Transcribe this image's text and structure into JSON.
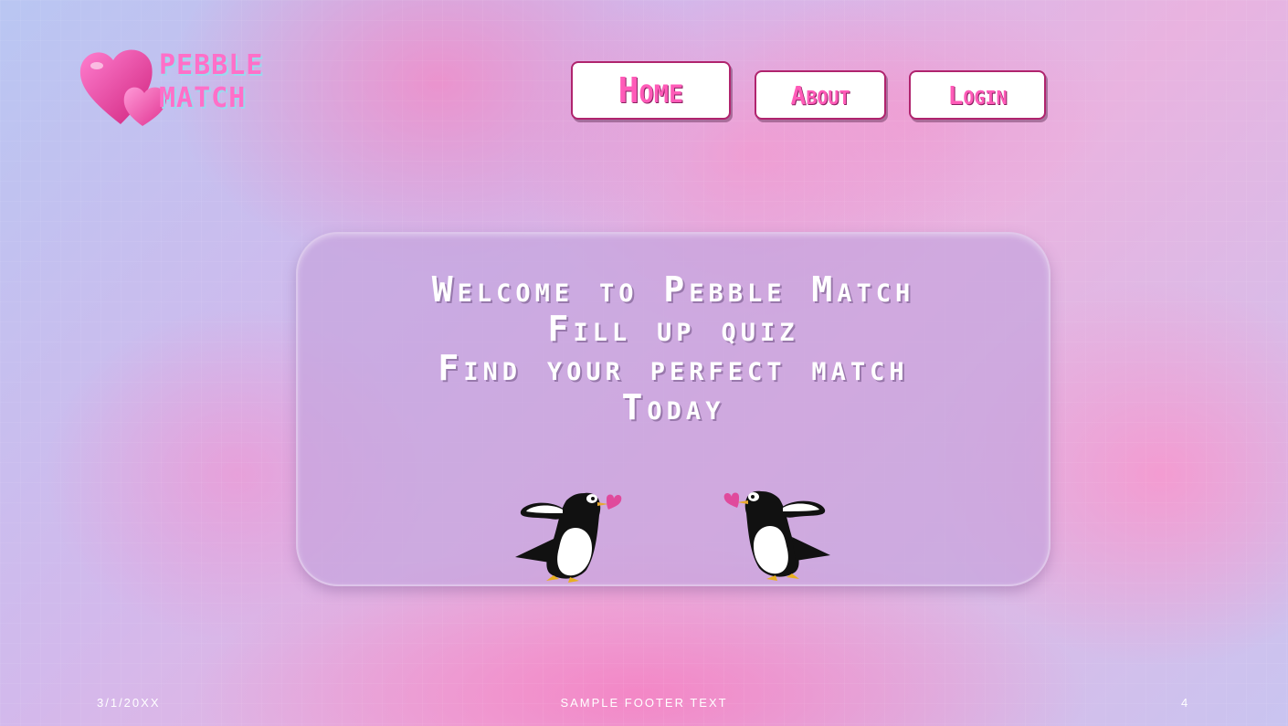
{
  "logo": {
    "line1": "Pebble",
    "line2": "Match",
    "icon": "hearts-icon"
  },
  "nav": {
    "home": "Home",
    "about": "About",
    "login": "Login"
  },
  "welcome": {
    "lines": [
      "Welcome to Pebble Match",
      "Fill up quiz",
      "Find your perfect match",
      "Today"
    ]
  },
  "illustration": {
    "left": "penguin-with-heart-icon",
    "right": "penguin-with-heart-icon"
  },
  "footer": {
    "date": "3/1/20XX",
    "text": "SAMPLE FOOTER TEXT",
    "page": "4"
  },
  "colors": {
    "accent": "#ff5bb8",
    "button_border": "#b0246e",
    "panel": "#c6a5de",
    "text_light": "#ffffff"
  }
}
